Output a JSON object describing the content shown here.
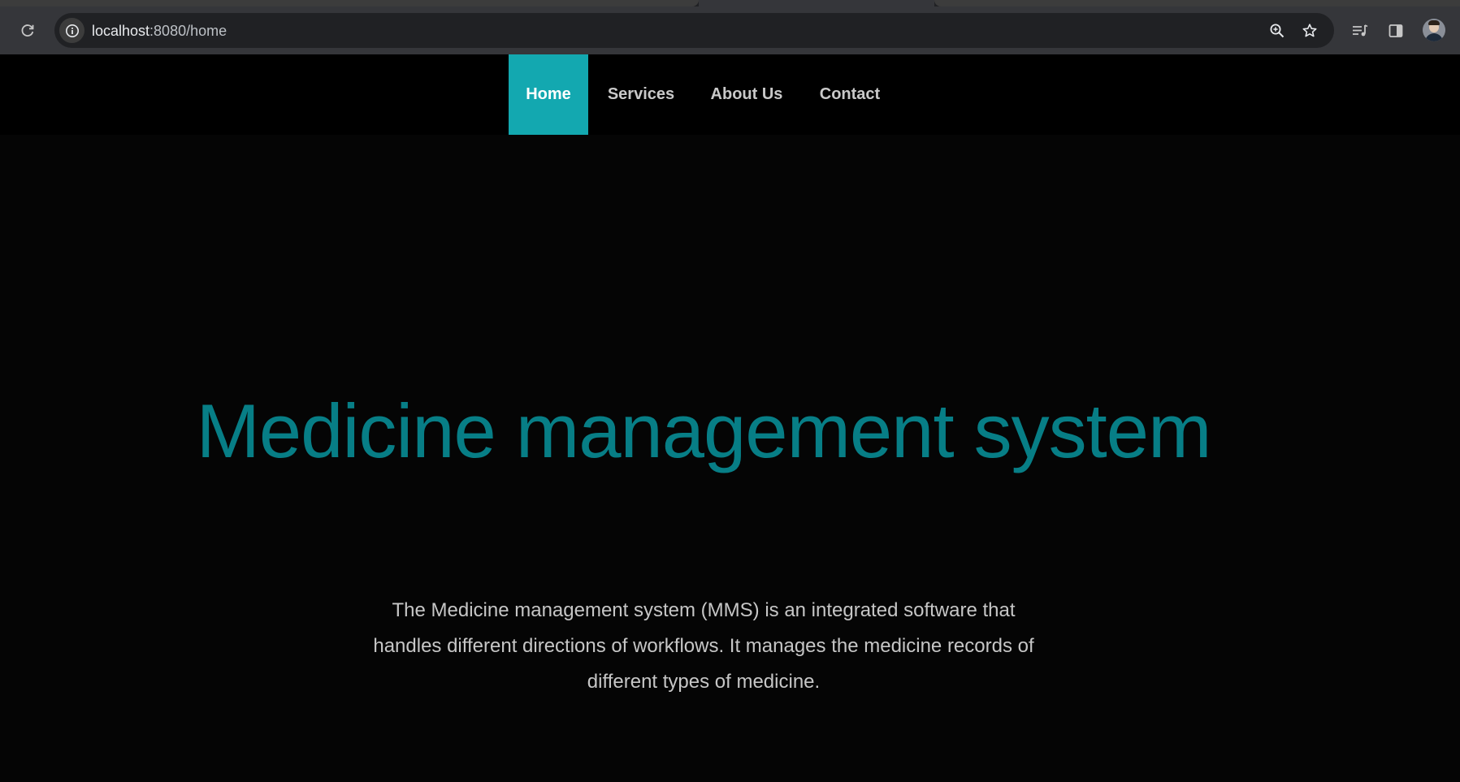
{
  "browser": {
    "url_host": "localhost",
    "url_path": ":8080/home",
    "icons": {
      "reload": "reload-icon",
      "site_info": "info-icon",
      "zoom": "zoom-icon",
      "bookmark": "star-icon",
      "reading_list": "reading-list-icon",
      "side_panel": "side-panel-icon",
      "profile": "avatar"
    }
  },
  "nav": {
    "items": [
      {
        "label": "Home",
        "active": true
      },
      {
        "label": "Services",
        "active": false
      },
      {
        "label": "About Us",
        "active": false
      },
      {
        "label": "Contact",
        "active": false
      }
    ],
    "active_color": "#13a8b0"
  },
  "hero": {
    "title": "Medicine management system",
    "title_color": "#077e86",
    "description": "The Medicine management system (MMS) is an integrated software that handles different directions of workflows. It manages the medicine records of different types of medicine."
  },
  "colors": {
    "background": "#050505",
    "nav_background": "#000000"
  }
}
